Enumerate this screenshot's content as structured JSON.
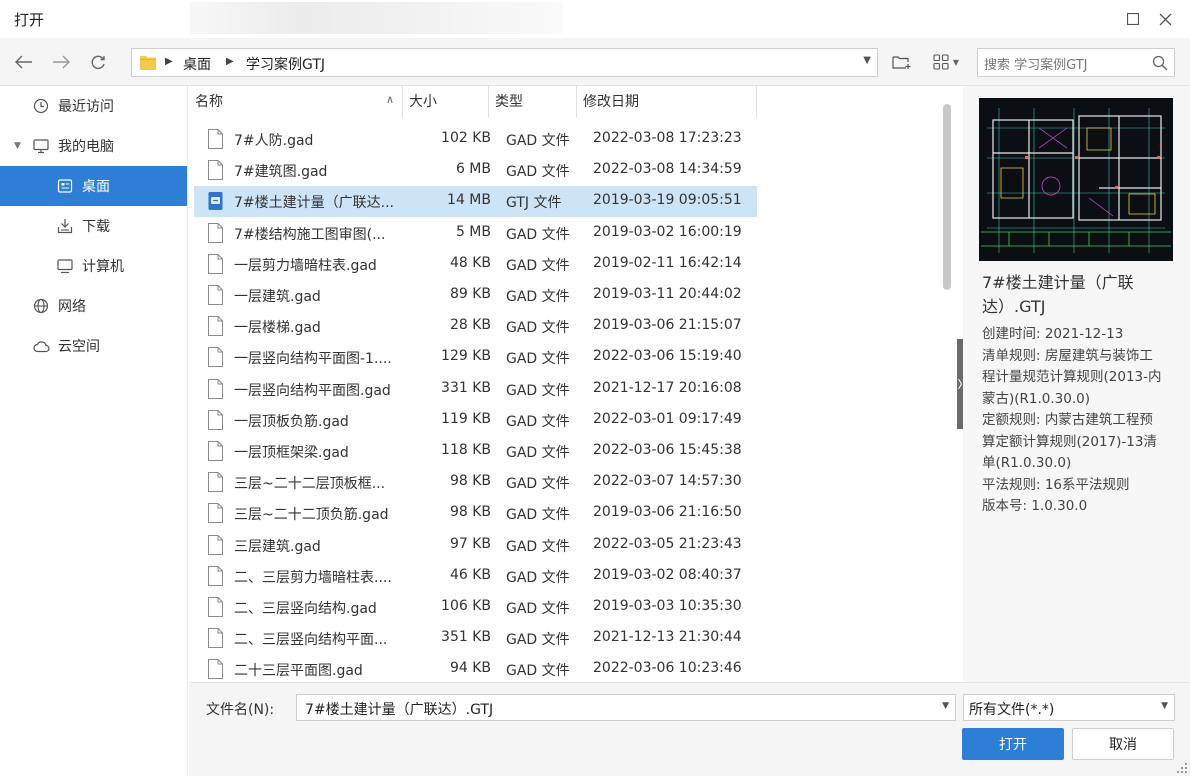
{
  "window": {
    "title": "打开"
  },
  "address_bar": {
    "crumbs": [
      "桌面",
      "学习案例GTJ"
    ]
  },
  "search": {
    "placeholder": "搜索 学习案例GTJ"
  },
  "sidebar": {
    "items": [
      {
        "label": "最近访问",
        "icon": "clock-icon"
      },
      {
        "label": "我的电脑",
        "icon": "monitor-icon"
      },
      {
        "label": "桌面",
        "icon": "desktop-icon"
      },
      {
        "label": "下载",
        "icon": "download-icon"
      },
      {
        "label": "计算机",
        "icon": "computer-icon"
      },
      {
        "label": "网络",
        "icon": "globe-icon"
      },
      {
        "label": "云空间",
        "icon": "cloud-icon"
      }
    ]
  },
  "columns": {
    "name": "名称",
    "size": "大小",
    "type": "类型",
    "date": "修改日期"
  },
  "files": [
    {
      "name": "7#人防.gad",
      "size": "102 KB",
      "type": "GAD 文件",
      "date": "2022-03-08 17:23:23"
    },
    {
      "name": "7#建筑图.gad",
      "size": "6 MB",
      "type": "GAD 文件",
      "date": "2022-03-08 14:34:59"
    },
    {
      "name": "7#楼土建计量（广联达...",
      "size": "14 MB",
      "type": "GTJ 文件",
      "date": "2019-03-19 09:05:51"
    },
    {
      "name": "7#楼结构施工图审图(...",
      "size": "5 MB",
      "type": "GAD 文件",
      "date": "2019-03-02 16:00:19"
    },
    {
      "name": "一层剪力墙暗柱表.gad",
      "size": "48 KB",
      "type": "GAD 文件",
      "date": "2019-02-11 16:42:14"
    },
    {
      "name": "一层建筑.gad",
      "size": "89 KB",
      "type": "GAD 文件",
      "date": "2019-03-11 20:44:02"
    },
    {
      "name": "一层楼梯.gad",
      "size": "28 KB",
      "type": "GAD 文件",
      "date": "2019-03-06 21:15:07"
    },
    {
      "name": "一层竖向结构平面图-1....",
      "size": "129 KB",
      "type": "GAD 文件",
      "date": "2022-03-06 15:19:40"
    },
    {
      "name": "一层竖向结构平面图.gad",
      "size": "331 KB",
      "type": "GAD 文件",
      "date": "2021-12-17 20:16:08"
    },
    {
      "name": "一层顶板负筋.gad",
      "size": "119 KB",
      "type": "GAD 文件",
      "date": "2022-03-01 09:17:49"
    },
    {
      "name": "一层顶框架梁.gad",
      "size": "118 KB",
      "type": "GAD 文件",
      "date": "2022-03-06 15:45:38"
    },
    {
      "name": "三层~二十二层顶板框...",
      "size": "98 KB",
      "type": "GAD 文件",
      "date": "2022-03-07 14:57:30"
    },
    {
      "name": "三层~二十二顶负筋.gad",
      "size": "98 KB",
      "type": "GAD 文件",
      "date": "2019-03-06 21:16:50"
    },
    {
      "name": "三层建筑.gad",
      "size": "97 KB",
      "type": "GAD 文件",
      "date": "2022-03-05 21:23:43"
    },
    {
      "name": "二、三层剪力墙暗柱表....",
      "size": "46 KB",
      "type": "GAD 文件",
      "date": "2019-03-02 08:40:37"
    },
    {
      "name": "二、三层竖向结构.gad",
      "size": "106 KB",
      "type": "GAD 文件",
      "date": "2019-03-03 10:35:30"
    },
    {
      "name": "二、三层竖向结构平面...",
      "size": "351 KB",
      "type": "GAD 文件",
      "date": "2021-12-13 21:30:44"
    },
    {
      "name": "二十三层平面图.gad",
      "size": "94 KB",
      "type": "GAD 文件",
      "date": "2022-03-06 10:23:46"
    }
  ],
  "preview": {
    "title": "7#楼土建计量（广联达）.GTJ",
    "meta": [
      "创建时间: 2021-12-13",
      "清单规则: 房屋建筑与装饰工程计量规范计算规则(2013-内蒙古)(R1.0.30.0)",
      "定额规则: 内蒙古建筑工程预算定额计算规则(2017)-13清单(R1.0.30.0)",
      "平法规则: 16系平法规则",
      "版本号: 1.0.30.0"
    ]
  },
  "footer": {
    "filename_label": "文件名(N):",
    "filename_value": "7#楼土建计量（广联达）.GTJ",
    "filetype_value": "所有文件(*.*)",
    "open_label": "打开",
    "cancel_label": "取消"
  },
  "colors": {
    "accent": "#2d7fd5",
    "selected_row": "#cde3f6",
    "gtj_icon": "#2f74c8"
  }
}
